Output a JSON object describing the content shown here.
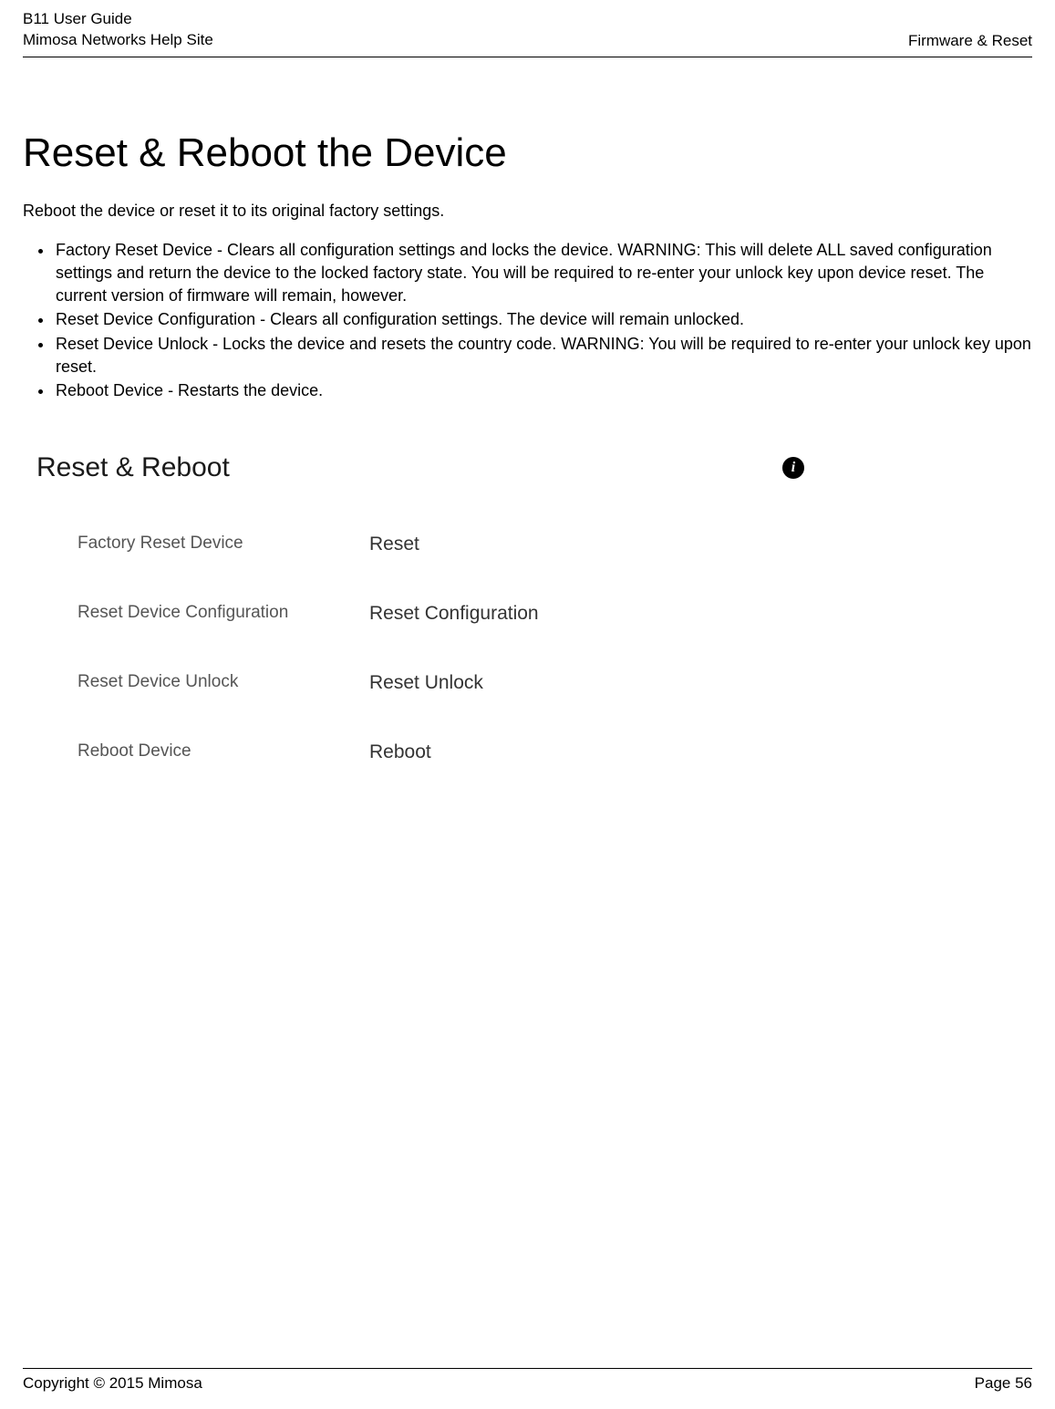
{
  "header": {
    "guide": "B11 User Guide",
    "site": "Mimosa Networks Help Site",
    "section": "Firmware & Reset"
  },
  "page": {
    "title": "Reset & Reboot the Device",
    "intro": "Reboot the device or reset it to its original factory settings.",
    "bullets": [
      "Factory Reset Device - Clears all configuration settings and locks the device. WARNING: This will delete ALL saved configuration settings and return the device to the locked factory state. You will be required to re-enter your unlock key upon device reset. The current version of firmware will remain, however.",
      "Reset Device Configuration - Clears all configuration settings. The device will remain unlocked.",
      "Reset Device Unlock - Locks the device and resets the country code. WARNING: You will be required to re-enter your unlock key upon reset.",
      "Reboot Device - Restarts the device."
    ]
  },
  "panel": {
    "title": "Reset & Reboot",
    "info_glyph": "i",
    "rows": [
      {
        "label": "Factory Reset Device",
        "action": "Reset"
      },
      {
        "label": "Reset Device Configuration",
        "action": "Reset Configuration"
      },
      {
        "label": "Reset Device Unlock",
        "action": "Reset Unlock"
      },
      {
        "label": "Reboot Device",
        "action": "Reboot"
      }
    ]
  },
  "footer": {
    "copyright": "Copyright © 2015 Mimosa",
    "page": "Page 56"
  }
}
